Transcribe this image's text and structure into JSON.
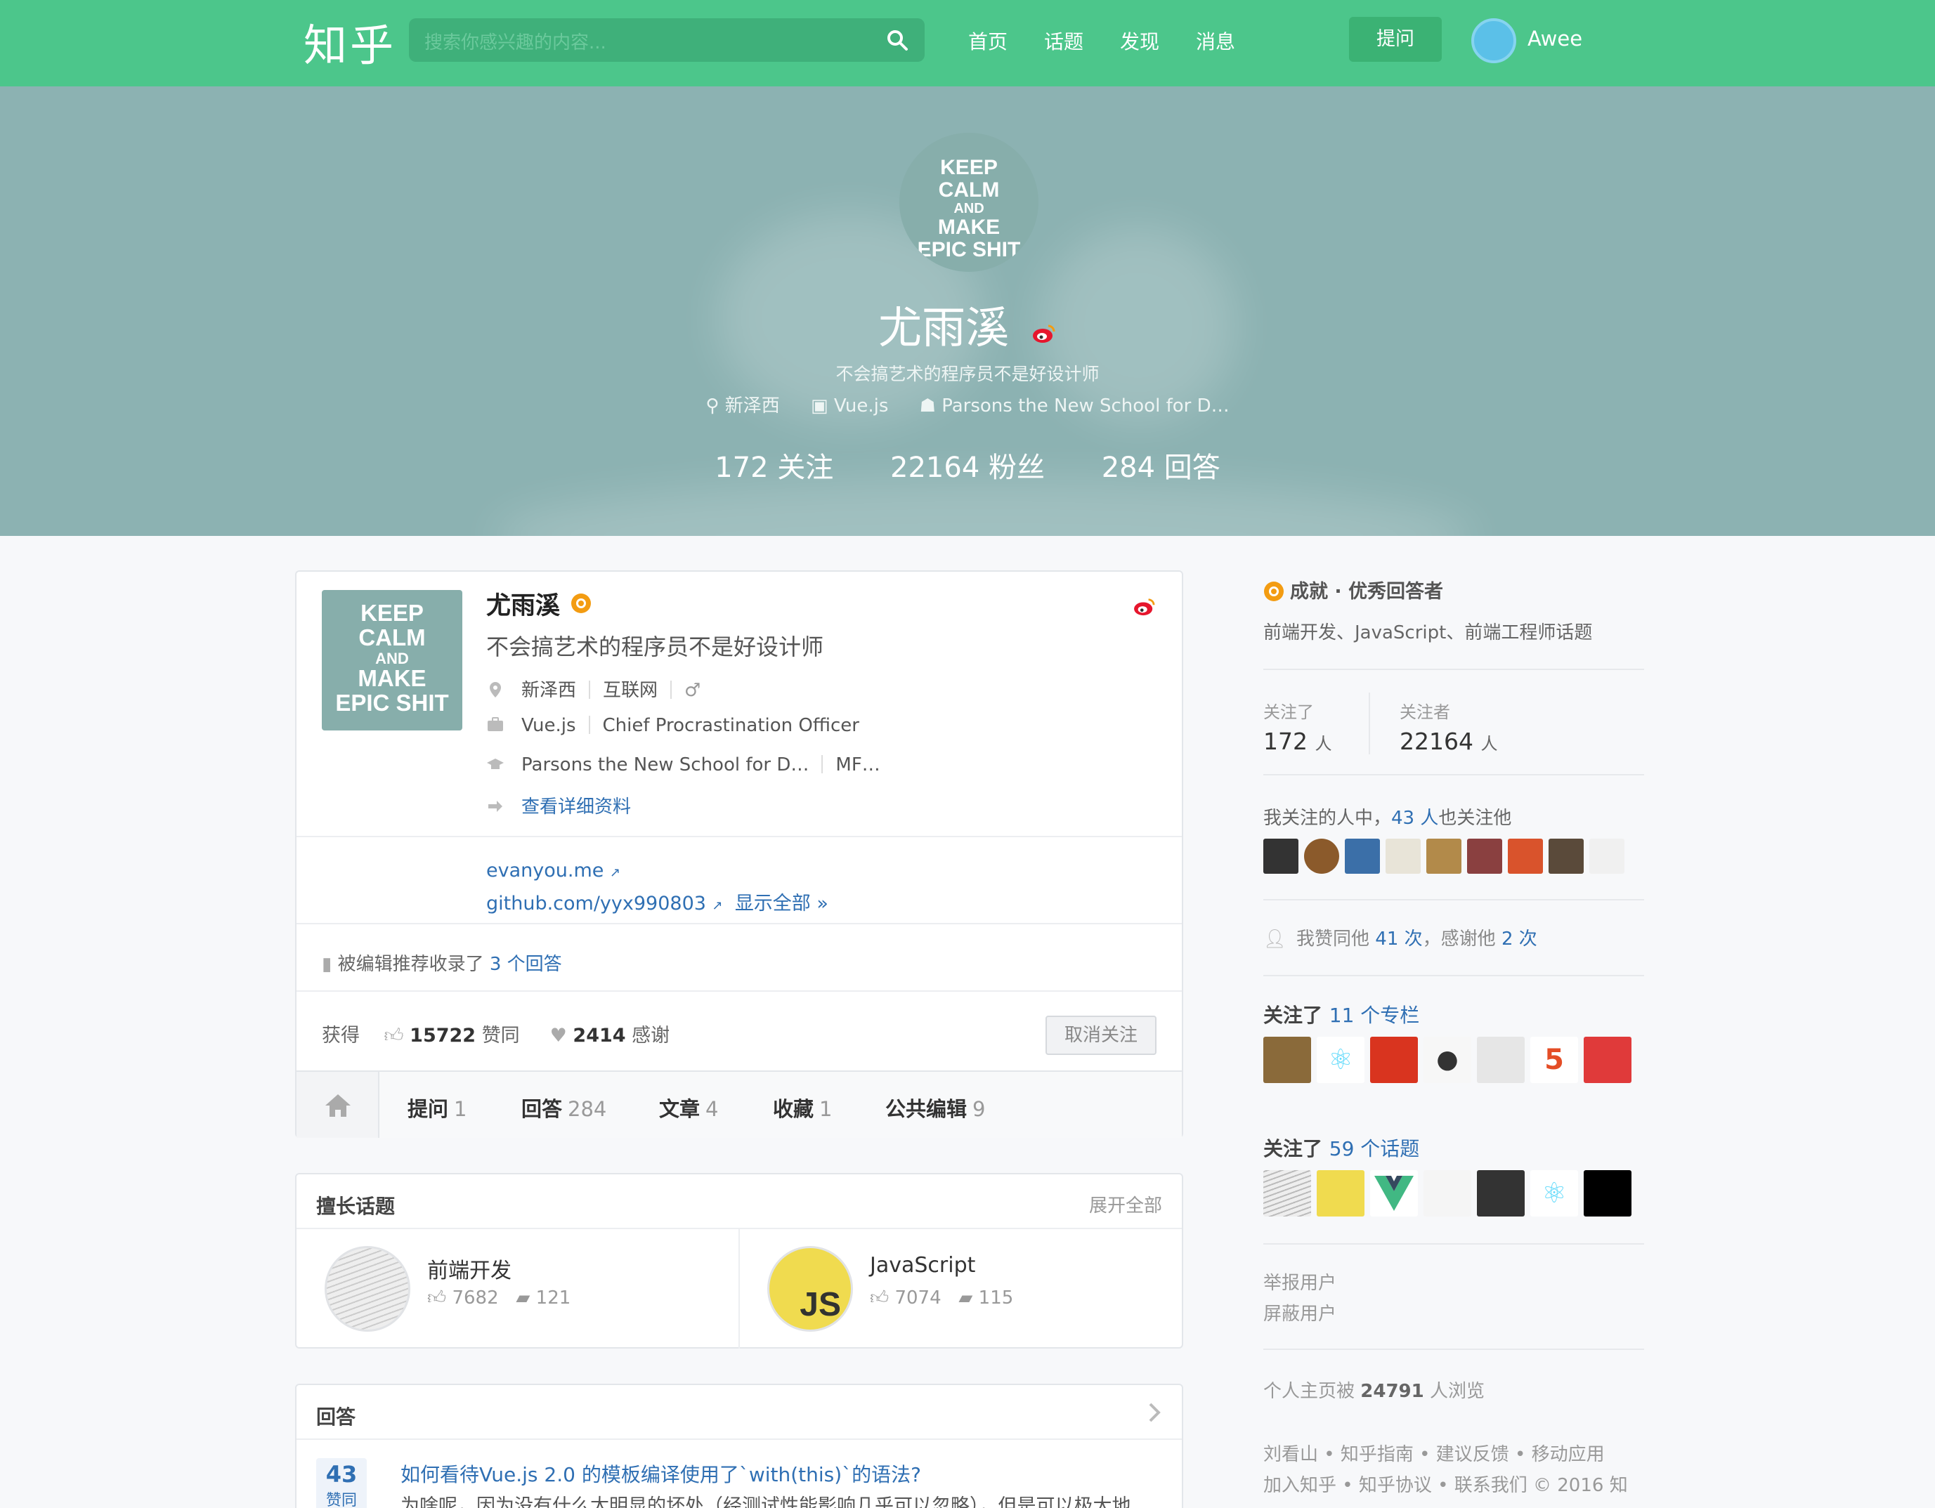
{
  "header": {
    "logo": "知乎",
    "search_placeholder": "搜索你感兴趣的内容...",
    "nav": [
      "首页",
      "话题",
      "发现",
      "消息"
    ],
    "ask_label": "提问",
    "user_name": "Awee"
  },
  "hero": {
    "avatar_lines": [
      "KEEP",
      "CALM",
      "AND",
      "MAKE",
      "EPIC SHIT"
    ],
    "name": "尤雨溪",
    "bio": "不会搞艺术的程序员不是好设计师",
    "location": "新泽西",
    "company": "Vue.js",
    "school": "Parsons the New School for D…",
    "stats": [
      "172 关注",
      "22164 粉丝",
      "284 回答"
    ]
  },
  "profile": {
    "name": "尤雨溪",
    "bio": "不会搞艺术的程序员不是好设计师",
    "location": "新泽西",
    "industry": "互联网",
    "gender": "♂",
    "company": "Vue.js",
    "position": "Chief Procrastination Officer",
    "school": "Parsons the New School for D…",
    "major": "MF…",
    "details_link": "查看详细资料",
    "link1": "evanyou.me",
    "link2": "github.com/yyx990803",
    "show_all": "显示全部 »",
    "editor_prefix": "被编辑推荐收录了",
    "editor_count": "3 个回答",
    "earn_label": "获得",
    "upvotes": "15722",
    "upvotes_label": "赞同",
    "thanks": "2414",
    "thanks_label": "感谢",
    "unfollow_label": "取消关注"
  },
  "tabs": [
    {
      "label": "提问",
      "count": "1"
    },
    {
      "label": "回答",
      "count": "284"
    },
    {
      "label": "文章",
      "count": "4"
    },
    {
      "label": "收藏",
      "count": "1"
    },
    {
      "label": "公共编辑",
      "count": "9"
    }
  ],
  "topics": {
    "title": "擅长话题",
    "expand": "展开全部",
    "items": [
      {
        "name": "前端开发",
        "likes": "7682",
        "comments": "121"
      },
      {
        "name": "JavaScript",
        "likes": "7074",
        "comments": "115"
      }
    ]
  },
  "answers": {
    "title": "回答",
    "vote_count": "43",
    "vote_label": "赞同",
    "item_title": "如何看待Vue.js 2.0 的模板编译使用了`with(this)`的语法?",
    "excerpt": "为啥呢，因为没有什么太明显的坏处（经测试性能影响几乎可以忽略），但是可以极大地…"
  },
  "sidebar": {
    "achievement_label": "成就",
    "achievement_value": "优秀回答者",
    "achievement_topics": "前端开发、JavaScript、前端工程师话题",
    "following_label": "关注了",
    "following_count": "172",
    "follower_label": "关注者",
    "follower_count": "22164",
    "people_unit": "人",
    "mutual_prefix": "我关注的人中，",
    "mutual_count": "43 人",
    "mutual_suffix": "也关注他",
    "agree_prefix": "我赞同他",
    "agree_count": "41 次",
    "thank_prefix": "，感谢他",
    "thank_count": "2 次",
    "columns_prefix": "关注了",
    "columns_count": "11 个专栏",
    "topics_prefix": "关注了",
    "topics_count": "59 个话题",
    "report": "举报用户",
    "block": "屏蔽用户",
    "views_prefix": "个人主页被",
    "views_count": "24791",
    "views_suffix": "人浏览",
    "footer_line1": "刘看山 • 知乎指南 • 建议反馈 • 移动应用",
    "footer_line2": "加入知乎 • 知乎协议 • 联系我们 © 2016 知"
  },
  "colors": {
    "brand": "#4cc68b",
    "hero": "#8cb2b2",
    "link": "#2f6fb3"
  }
}
